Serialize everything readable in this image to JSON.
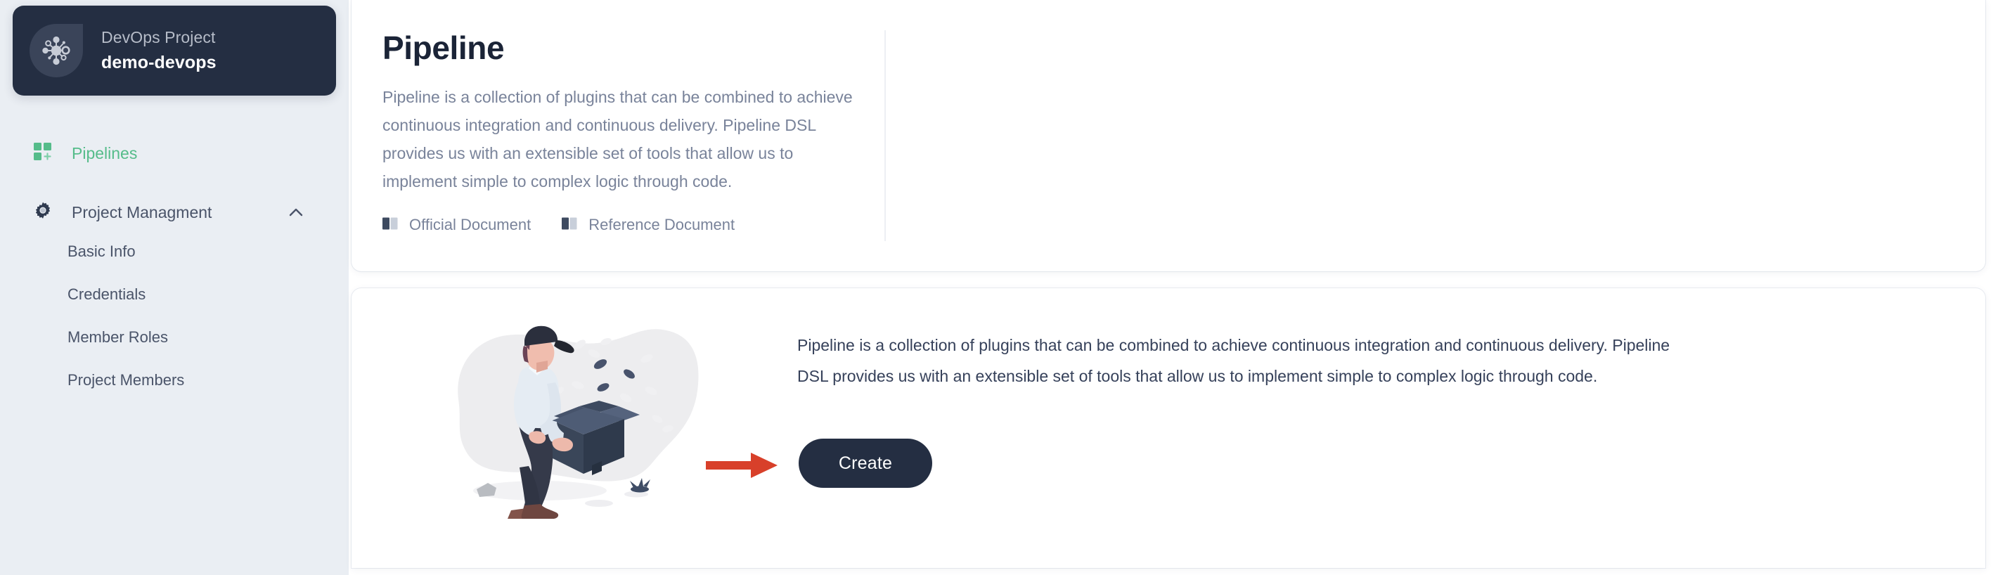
{
  "colors": {
    "sidebar_bg": "#eaeef3",
    "project_card_bg": "#242e42",
    "accent_green": "#55bc8a",
    "text_muted": "#79839a",
    "text_dark": "#1b2437",
    "arrow_red": "#d8402a",
    "button_dark": "#242e42"
  },
  "sidebar": {
    "project": {
      "logo_icon": "network-nodes-icon",
      "subtitle": "DevOps Project",
      "name": "demo-devops"
    },
    "nav": [
      {
        "id": "pipelines",
        "label": "Pipelines",
        "icon": "grid-add-icon",
        "active": true
      },
      {
        "id": "project-managment",
        "label": "Project Managment",
        "icon": "gear-icon",
        "expanded": true,
        "chevron": "chevron-up-icon"
      }
    ],
    "sub_items": [
      {
        "id": "basic-info",
        "label": "Basic Info"
      },
      {
        "id": "credentials",
        "label": "Credentials"
      },
      {
        "id": "member-roles",
        "label": "Member Roles"
      },
      {
        "id": "project-members",
        "label": "Project Members"
      }
    ]
  },
  "intro_card": {
    "title": "Pipeline",
    "description": "Pipeline is a collection of plugins that can be combined to achieve continuous integration and continuous delivery. Pipeline DSL provides us with an extensible set of tools that allow us to implement simple to complex logic through code.",
    "links": [
      {
        "id": "official-document",
        "label": "Official Document",
        "icon": "book-icon"
      },
      {
        "id": "reference-document",
        "label": "Reference Document",
        "icon": "book-icon"
      }
    ]
  },
  "empty_card": {
    "illustration": "person-holding-open-box-illustration",
    "description": "Pipeline is a collection of plugins that can be combined to achieve continuous integration and continuous delivery. Pipeline DSL provides us with an extensible set of tools that allow us to implement simple to complex logic through code.",
    "arrow": "red-right-arrow-annotation",
    "create_button": "Create"
  }
}
